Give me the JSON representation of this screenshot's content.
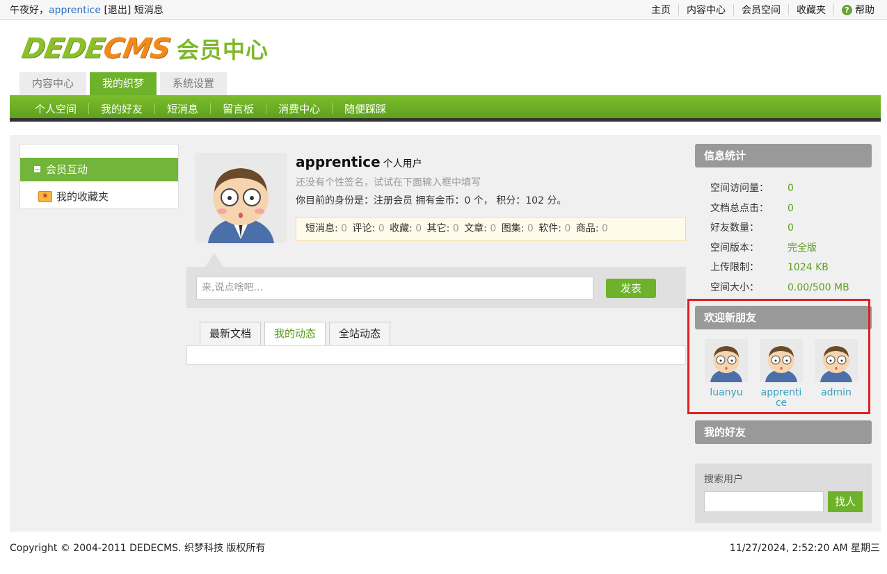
{
  "topbar": {
    "greeting": "午夜好，",
    "username": "apprentice",
    "logout": "[退出]",
    "messages": "短消息",
    "links": [
      "主页",
      "内容中心",
      "会员空间",
      "收藏夹"
    ],
    "help": "帮助"
  },
  "logo": {
    "dede": "DEDE",
    "cms": "CMS",
    "title": "会员中心"
  },
  "tabs": [
    "内容中心",
    "我的织梦",
    "系统设置"
  ],
  "active_tab": "我的织梦",
  "nav": [
    "个人空间",
    "我的好友",
    "短消息",
    "留言板",
    "消费中心",
    "随便踩踩"
  ],
  "sidebar": {
    "group": "会员互动",
    "item": "我的收藏夹"
  },
  "profile": {
    "username": "apprentice",
    "user_type": "个人用户",
    "signature": "还没有个性签名，试试在下面输入框中填写",
    "identity": "你目前的身份是：注册会员 拥有金币：0 个， 积分：102 分。",
    "stats": [
      {
        "label": "短消息:",
        "value": "0"
      },
      {
        "label": "评论:",
        "value": "0"
      },
      {
        "label": "收藏:",
        "value": "0"
      },
      {
        "label": "其它:",
        "value": "0"
      },
      {
        "label": "文章:",
        "value": "0"
      },
      {
        "label": "图集:",
        "value": "0"
      },
      {
        "label": "软件:",
        "value": "0"
      },
      {
        "label": "商品:",
        "value": "0"
      }
    ]
  },
  "post": {
    "placeholder": "来,说点啥吧...",
    "button": "发表"
  },
  "feed_tabs": [
    "最新文档",
    "我的动态",
    "全站动态"
  ],
  "active_feed_tab": "我的动态",
  "info": {
    "title": "信息统计",
    "rows": [
      {
        "k": "空间访问量：",
        "v": "0"
      },
      {
        "k": "文档总点击：",
        "v": "0"
      },
      {
        "k": "好友数量：",
        "v": "0"
      },
      {
        "k": "空间版本：",
        "v": "完全版"
      },
      {
        "k": "上传限制：",
        "v": "1024 KB"
      },
      {
        "k": "空间大小：",
        "v": "0.00/500 MB"
      }
    ]
  },
  "new_friends": {
    "title": "欢迎新朋友",
    "users": [
      "luanyu",
      "apprentice",
      "admin"
    ]
  },
  "my_friends": {
    "title": "我的好友"
  },
  "search": {
    "label": "搜索用户",
    "button": "找人"
  },
  "footer": {
    "copyright": "Copyright © 2004-2011 DEDECMS. 织梦科技 版权所有",
    "datetime": "11/27/2024, 2:52:20 AM 星期三"
  },
  "colors": {
    "accent": "#6db22a",
    "highlight_box": "#e02020",
    "link": "#3aa0c0"
  }
}
